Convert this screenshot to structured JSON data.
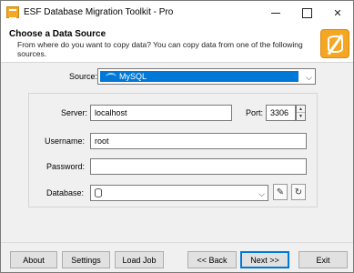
{
  "window": {
    "title": "ESF Database Migration Toolkit - Pro"
  },
  "header": {
    "title": "Choose a Data Source",
    "description": "From where do you want to copy data? You can copy data from one of the following sources."
  },
  "source": {
    "label": "Source:",
    "value": "MySQL"
  },
  "connection": {
    "server_label": "Server:",
    "server_value": "localhost",
    "port_label": "Port:",
    "port_value": "3306",
    "username_label": "Username:",
    "username_value": "root",
    "password_label": "Password:",
    "password_value": "",
    "database_label": "Database:",
    "database_value": ""
  },
  "buttons": {
    "about": "About",
    "settings": "Settings",
    "load_job": "Load Job",
    "back": "<< Back",
    "next": "Next >>",
    "exit": "Exit"
  },
  "colors": {
    "accent": "#0078d7",
    "brand": "#f5a623"
  }
}
